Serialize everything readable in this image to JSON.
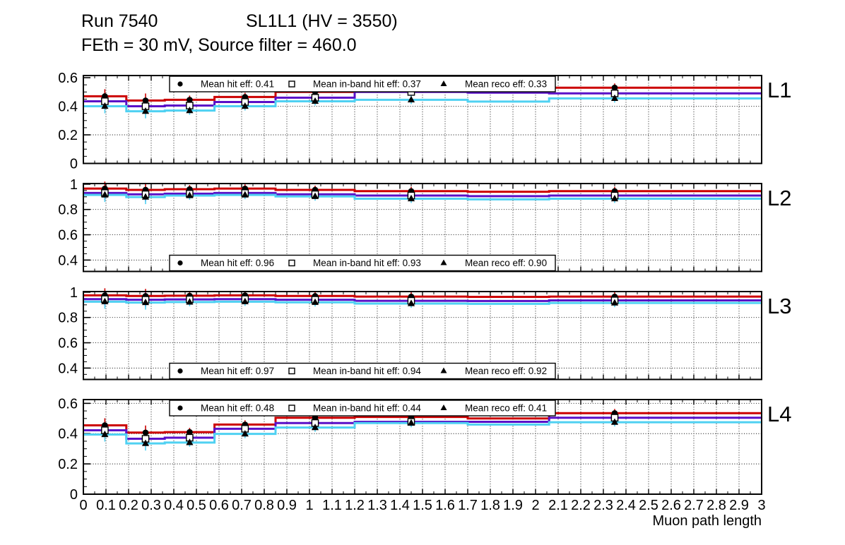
{
  "header": {
    "run_label": "Run 7540",
    "condition_label": "SL1L1 (HV = 3550)",
    "subtitle": "FEth = 30 mV, Source filter = 460.0"
  },
  "colors": {
    "hit": "#cc0000",
    "inband": "#5a10c8",
    "reco": "#4fd1f2",
    "marker": "#000000",
    "frame": "#000000",
    "legend_bg": "#ffffff"
  },
  "xaxis": {
    "title": "Muon path length",
    "min": 0,
    "max": 3,
    "tick_values": [
      0,
      0.1,
      0.2,
      0.3,
      0.4,
      0.5,
      0.6,
      0.7,
      0.8,
      0.9,
      1,
      1.1,
      1.2,
      1.3,
      1.4,
      1.5,
      1.6,
      1.7,
      1.8,
      1.9,
      2,
      2.1,
      2.2,
      2.3,
      2.4,
      2.5,
      2.6,
      2.7,
      2.8,
      2.9,
      3
    ],
    "tick_labels": [
      "0",
      "0.1",
      "0.2",
      "0.3",
      "0.4",
      "0.5",
      "0.6",
      "0.7",
      "0.8",
      "0.9",
      "1",
      "1.1",
      "1.2",
      "1.3",
      "1.4",
      "1.5",
      "1.6",
      "1.7",
      "1.8",
      "1.9",
      "2",
      "2.1",
      "2.2",
      "2.3",
      "2.4",
      "2.5",
      "2.6",
      "2.7",
      "2.8",
      "2.9",
      "3"
    ]
  },
  "chart_data": [
    {
      "type": "step-line",
      "panel_label": "L1",
      "ylim": [
        0,
        0.615
      ],
      "ytick_values": [
        0,
        0.2,
        0.4,
        0.6
      ],
      "ytick_labels": [
        "0",
        "0.2",
        "0.4",
        "0.6"
      ],
      "legend": {
        "position": "top",
        "entries": [
          {
            "marker": "circle",
            "label": "Mean hit  eff: 0.41"
          },
          {
            "marker": "square",
            "label": "Mean in-band hit eff: 0.37"
          },
          {
            "marker": "triangle",
            "label": "Mean reco eff: 0.33"
          }
        ]
      },
      "means": {
        "hit": 0.41,
        "inband": 0.37,
        "reco": 0.33
      },
      "bin_edges": [
        0,
        0.19,
        0.36,
        0.58,
        0.85,
        1.2,
        1.7,
        2.06,
        3.0
      ],
      "marker_x": [
        0.095,
        0.275,
        0.47,
        0.715,
        1.025,
        1.45,
        null,
        2.35
      ],
      "series": [
        {
          "name": "hit",
          "marker": "circle",
          "values": [
            0.47,
            0.44,
            0.445,
            0.465,
            0.5,
            0.51,
            0.5,
            0.53
          ]
        },
        {
          "name": "inband",
          "marker": "square",
          "values": [
            0.435,
            0.4,
            0.405,
            0.43,
            0.46,
            0.5,
            0.495,
            0.49
          ]
        },
        {
          "name": "reco",
          "marker": "triangle",
          "values": [
            0.4,
            0.365,
            0.37,
            0.4,
            0.435,
            0.445,
            0.433,
            0.455
          ]
        }
      ]
    },
    {
      "type": "step-line",
      "panel_label": "L2",
      "ylim": [
        0.31,
        1.005
      ],
      "ytick_values": [
        0.4,
        0.6,
        0.8,
        1
      ],
      "ytick_labels": [
        "0.4",
        "0.6",
        "0.8",
        "1"
      ],
      "legend": {
        "position": "bottom",
        "entries": [
          {
            "marker": "circle",
            "label": "Mean hit  eff: 0.96"
          },
          {
            "marker": "square",
            "label": "Mean in-band hit eff: 0.93"
          },
          {
            "marker": "triangle",
            "label": "Mean reco eff: 0.90"
          }
        ]
      },
      "means": {
        "hit": 0.96,
        "inband": 0.93,
        "reco": 0.9
      },
      "bin_edges": [
        0,
        0.19,
        0.36,
        0.58,
        0.85,
        1.2,
        1.7,
        2.06,
        3.0
      ],
      "marker_x": [
        0.095,
        0.275,
        0.47,
        0.715,
        1.025,
        1.45,
        null,
        2.35
      ],
      "series": [
        {
          "name": "hit",
          "marker": "circle",
          "values": [
            0.965,
            0.955,
            0.96,
            0.965,
            0.955,
            0.945,
            0.94,
            0.945
          ]
        },
        {
          "name": "inband",
          "marker": "square",
          "values": [
            0.93,
            0.92,
            0.925,
            0.93,
            0.92,
            0.91,
            0.905,
            0.91
          ]
        },
        {
          "name": "reco",
          "marker": "triangle",
          "values": [
            0.915,
            0.898,
            0.91,
            0.915,
            0.903,
            0.885,
            0.88,
            0.885
          ]
        }
      ]
    },
    {
      "type": "step-line",
      "panel_label": "L3",
      "ylim": [
        0.31,
        1.005
      ],
      "ytick_values": [
        0.4,
        0.6,
        0.8,
        1
      ],
      "ytick_labels": [
        "0.4",
        "0.6",
        "0.8",
        "1"
      ],
      "legend": {
        "position": "bottom",
        "entries": [
          {
            "marker": "circle",
            "label": "Mean hit  eff: 0.97"
          },
          {
            "marker": "square",
            "label": "Mean in-band hit eff: 0.94"
          },
          {
            "marker": "triangle",
            "label": "Mean reco eff: 0.92"
          }
        ]
      },
      "means": {
        "hit": 0.97,
        "inband": 0.94,
        "reco": 0.92
      },
      "bin_edges": [
        0,
        0.19,
        0.36,
        0.58,
        0.85,
        1.2,
        1.7,
        2.06,
        3.0
      ],
      "marker_x": [
        0.095,
        0.275,
        0.47,
        0.715,
        1.025,
        1.45,
        null,
        2.35
      ],
      "series": [
        {
          "name": "hit",
          "marker": "circle",
          "values": [
            0.975,
            0.97,
            0.972,
            0.975,
            0.97,
            0.965,
            0.963,
            0.965
          ]
        },
        {
          "name": "inband",
          "marker": "square",
          "values": [
            0.945,
            0.94,
            0.943,
            0.945,
            0.94,
            0.932,
            0.93,
            0.935
          ]
        },
        {
          "name": "reco",
          "marker": "triangle",
          "values": [
            0.925,
            0.918,
            0.922,
            0.925,
            0.92,
            0.91,
            0.908,
            0.915
          ]
        }
      ]
    },
    {
      "type": "step-line",
      "panel_label": "L4",
      "ylim": [
        0,
        0.625
      ],
      "ytick_values": [
        0,
        0.2,
        0.4,
        0.6
      ],
      "ytick_labels": [
        "0",
        "0.2",
        "0.4",
        "0.6"
      ],
      "legend": {
        "position": "top",
        "entries": [
          {
            "marker": "circle",
            "label": "Mean hit  eff: 0.48"
          },
          {
            "marker": "square",
            "label": "Mean in-band hit eff: 0.44"
          },
          {
            "marker": "triangle",
            "label": "Mean reco eff: 0.41"
          }
        ]
      },
      "means": {
        "hit": 0.48,
        "inband": 0.44,
        "reco": 0.41
      },
      "bin_edges": [
        0,
        0.19,
        0.36,
        0.58,
        0.85,
        1.2,
        1.7,
        2.06,
        3.0
      ],
      "marker_x": [
        0.095,
        0.275,
        0.47,
        0.715,
        1.025,
        1.45,
        null,
        2.35
      ],
      "series": [
        {
          "name": "hit",
          "marker": "circle",
          "values": [
            0.455,
            0.407,
            0.41,
            0.46,
            0.505,
            0.51,
            0.5,
            0.535
          ]
        },
        {
          "name": "inband",
          "marker": "square",
          "values": [
            0.422,
            0.366,
            0.373,
            0.432,
            0.47,
            0.478,
            0.478,
            0.505
          ]
        },
        {
          "name": "reco",
          "marker": "triangle",
          "values": [
            0.394,
            0.335,
            0.341,
            0.398,
            0.44,
            0.47,
            0.46,
            0.475
          ]
        }
      ]
    }
  ]
}
